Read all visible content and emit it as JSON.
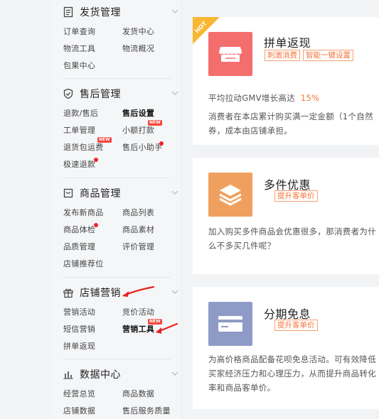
{
  "sidebar": {
    "sections": [
      {
        "title": "发货管理",
        "icon": "document-icon",
        "items": [
          "订单查询",
          "发货中心",
          "物流工具",
          "物流概况",
          "包果中心"
        ]
      },
      {
        "title": "售后管理",
        "icon": "shield-icon",
        "items": [
          "退款/售后",
          "售后设置",
          "工单管理",
          "小额打款",
          "退货包运费",
          "售后小助手",
          "极速退款"
        ]
      },
      {
        "title": "商品管理",
        "icon": "bag-icon",
        "items": [
          "发布新商品",
          "商品列表",
          "商品体检",
          "商品素材",
          "品质管理",
          "评价管理",
          "店铺推荐位"
        ]
      },
      {
        "title": "店铺营销",
        "icon": "gift-icon",
        "items": [
          "营销活动",
          "竞价活动",
          "短信营销",
          "营销工具",
          "拼单返现"
        ]
      },
      {
        "title": "数据中心",
        "icon": "bar-chart-icon",
        "items": [
          "经营总览",
          "商品数据",
          "店铺数据",
          "售后服务质量"
        ]
      }
    ],
    "new_badge": "NEW"
  },
  "cards": [
    {
      "hot": "HOT",
      "title": "拼单返现",
      "tags": [
        "刺激消费",
        "智能一键设置"
      ],
      "line1_prefix": "平均拉动GMV增长高达",
      "line1_pct": "15%",
      "desc": "消费者在本店累计购买满一定金额（1个自然",
      "desc2": "券，成本由店铺承担。",
      "icon_color": "#f46e6e"
    },
    {
      "title": "多件优惠",
      "tags": [
        "提升客单价"
      ],
      "desc": "加入购买多件商品会优惠很多，那消费者为什",
      "desc2": "么不多买几件呢？",
      "icon_color": "#f0a05e"
    },
    {
      "title": "分期免息",
      "tags": [
        "提升客单价"
      ],
      "desc": "为高价格商品配备花呗免息活动。可有效降低",
      "desc2": "买家经济压力和心理压力，从而提升商品转化",
      "desc3": "率和商品客单价。",
      "icon_color": "#8f9bc7"
    }
  ],
  "colors": {
    "accent_orange": "#f5743b",
    "annotation_red": "#e8231e"
  }
}
